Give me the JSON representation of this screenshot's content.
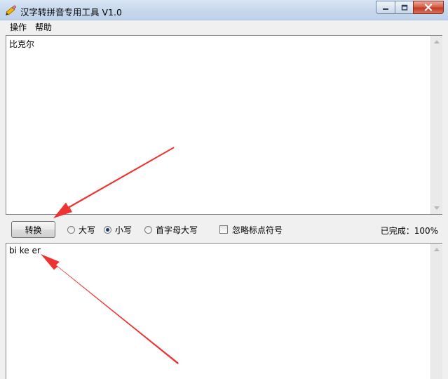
{
  "window": {
    "title": "汉字转拼音专用工具 V1.0",
    "app_icon": "pencil-icon",
    "caption_buttons": [
      "minimize-icon",
      "maximize-icon",
      "close-icon"
    ]
  },
  "menu": {
    "items": [
      {
        "label": "操作"
      },
      {
        "label": "帮助"
      }
    ]
  },
  "input": {
    "value": "比克尔"
  },
  "controls": {
    "convert_label": "转换",
    "options": [
      {
        "label": "大写",
        "selected": false
      },
      {
        "label": "小写",
        "selected": true
      },
      {
        "label": "首字母大写",
        "selected": false
      }
    ],
    "ignore_punct_label": "忽略标点符号",
    "ignore_punct_checked": false,
    "status_text": "已完成：100%"
  },
  "output": {
    "value": "bi ke er"
  },
  "colors": {
    "arrow": "#ee3333",
    "close_button": "#c7432a",
    "titlebar": "#c6d7ec"
  }
}
